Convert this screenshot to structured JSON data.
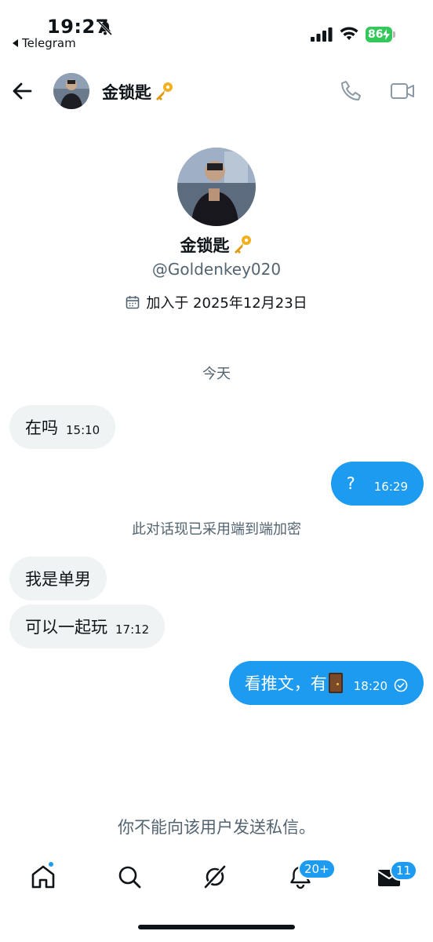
{
  "status_bar": {
    "time": "19:27",
    "back_app": "Telegram",
    "battery": "86"
  },
  "header": {
    "name": "金锁匙"
  },
  "profile": {
    "name": "金锁匙",
    "handle": "@Goldenkey020",
    "joined": "加入于 2025年12月23日"
  },
  "day_separator": "今天",
  "messages": [
    {
      "text": "在吗",
      "time": "15:10",
      "direction": "in"
    },
    {
      "text": "?",
      "time": "16:29",
      "direction": "out"
    },
    {
      "text": "我是单男",
      "time": "",
      "direction": "in"
    },
    {
      "text": "可以一起玩",
      "time": "17:12",
      "direction": "in"
    },
    {
      "text": "看推文，有",
      "time": "18:20",
      "direction": "out",
      "status": "read"
    }
  ],
  "encryption_note": "此对话现已采用端到端加密",
  "blocked_notice": "你不能向该用户发送私信。",
  "nav": {
    "notifications_badge": "20+",
    "messages_badge": "11"
  },
  "colors": {
    "accent": "#1d9bf0",
    "incoming_bubble": "#eff3f4",
    "battery": "#34c759",
    "secondary_text": "#536471"
  }
}
